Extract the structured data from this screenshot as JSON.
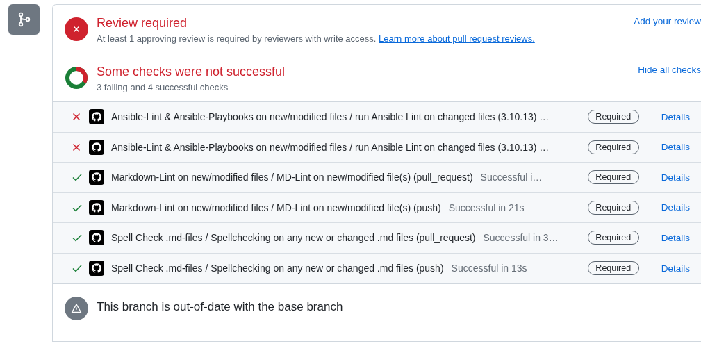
{
  "review": {
    "title": "Review required",
    "description": "At least 1 approving review is required by reviewers with write access.",
    "link": "Learn more about pull request reviews.",
    "action": "Add your review"
  },
  "checks": {
    "title": "Some checks were not successful",
    "summary": "3 failing and 4 successful checks",
    "action": "Hide all checks",
    "rows": [
      {
        "kind": "failure",
        "name": "Ansible-Lint & Ansible-Playbooks on new/modified files / run Ansible Lint on changed files (3.10.13) …",
        "badge": "Required",
        "link": "Details"
      },
      {
        "kind": "failure",
        "name": "Ansible-Lint & Ansible-Playbooks on new/modified files / run Ansible Lint on changed files (3.10.13) …",
        "badge": "Required",
        "link": "Details"
      },
      {
        "kind": "success",
        "name": "Markdown-Lint on new/modified files / MD-Lint on new/modified file(s) (pull_request)",
        "status": "Successful i…",
        "badge": "Required",
        "link": "Details"
      },
      {
        "kind": "success",
        "name": "Markdown-Lint on new/modified files / MD-Lint on new/modified file(s) (push)",
        "status": "Successful in 21s",
        "badge": "Required",
        "link": "Details"
      },
      {
        "kind": "success",
        "name": "Spell Check .md-files / Spellchecking on any new or changed .md files (pull_request)",
        "status": "Successful in 3…",
        "badge": "Required",
        "link": "Details"
      },
      {
        "kind": "success",
        "name": "Spell Check .md-files / Spellchecking on any new or changed .md files (push)",
        "status": "Successful in 13s",
        "badge": "Required",
        "link": "Details"
      }
    ]
  },
  "branch": {
    "title": "This branch is out-of-date with the base branch"
  }
}
